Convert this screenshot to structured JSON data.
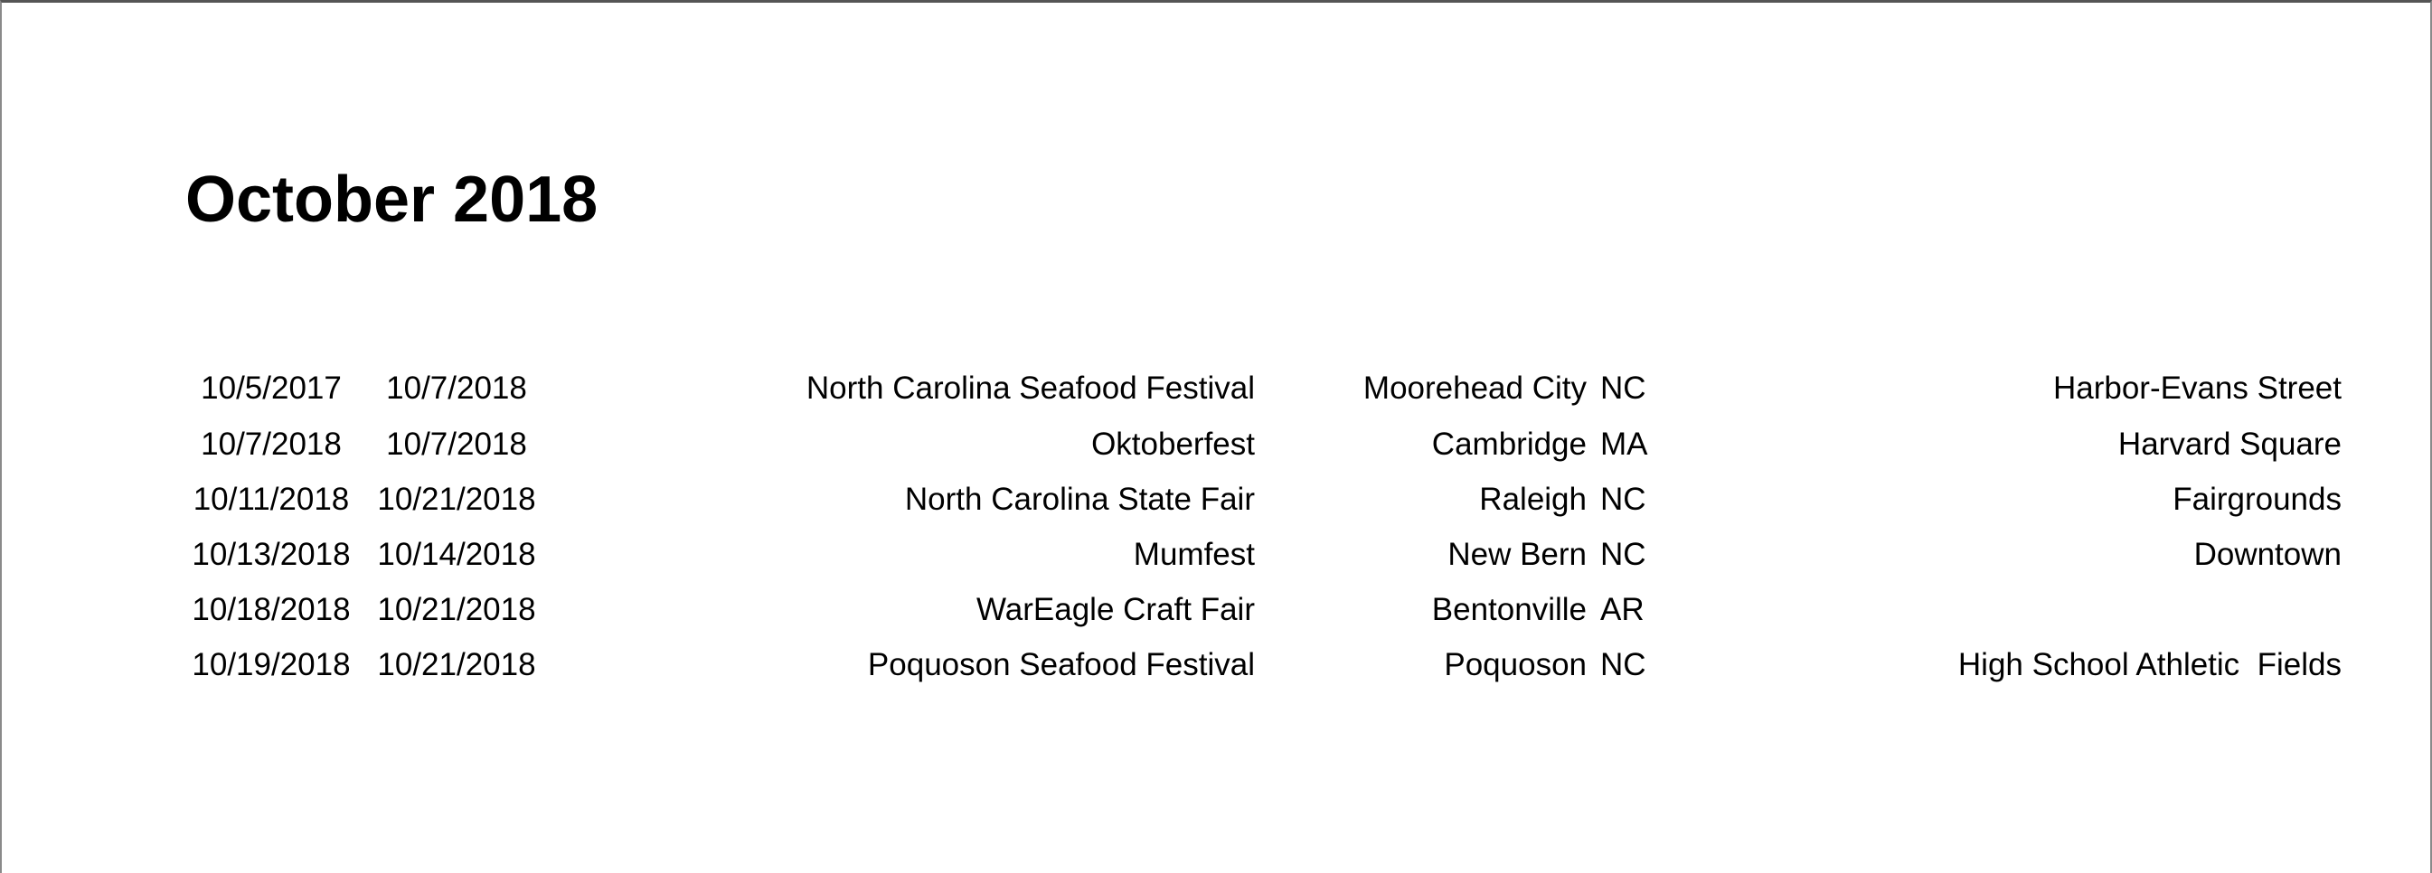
{
  "page": {
    "title": "October 2018"
  },
  "events": [
    {
      "start": "10/5/2017",
      "end": "10/7/2018",
      "name": "North Carolina Seafood Festival",
      "city": "Moorehead City",
      "state": "NC",
      "venue": "Harbor-Evans Street"
    },
    {
      "start": "10/7/2018",
      "end": "10/7/2018",
      "name": "Oktoberfest",
      "city": "Cambridge",
      "state": "MA",
      "venue": "Harvard Square"
    },
    {
      "start": "10/11/2018",
      "end": "10/21/2018",
      "name": "North Carolina State Fair",
      "city": "Raleigh",
      "state": "NC",
      "venue": "Fairgrounds"
    },
    {
      "start": "10/13/2018",
      "end": "10/14/2018",
      "name": "Mumfest",
      "city": "New Bern",
      "state": "NC",
      "venue": "Downtown"
    },
    {
      "start": "10/18/2018",
      "end": "10/21/2018",
      "name": "WarEagle Craft Fair",
      "city": "Bentonville",
      "state": "AR",
      "venue": ""
    },
    {
      "start": "10/19/2018",
      "end": "10/21/2018",
      "name": "Poquoson Seafood Festival",
      "city": "Poquoson",
      "state": "NC",
      "venue": "High School Athletic  Fields"
    }
  ]
}
